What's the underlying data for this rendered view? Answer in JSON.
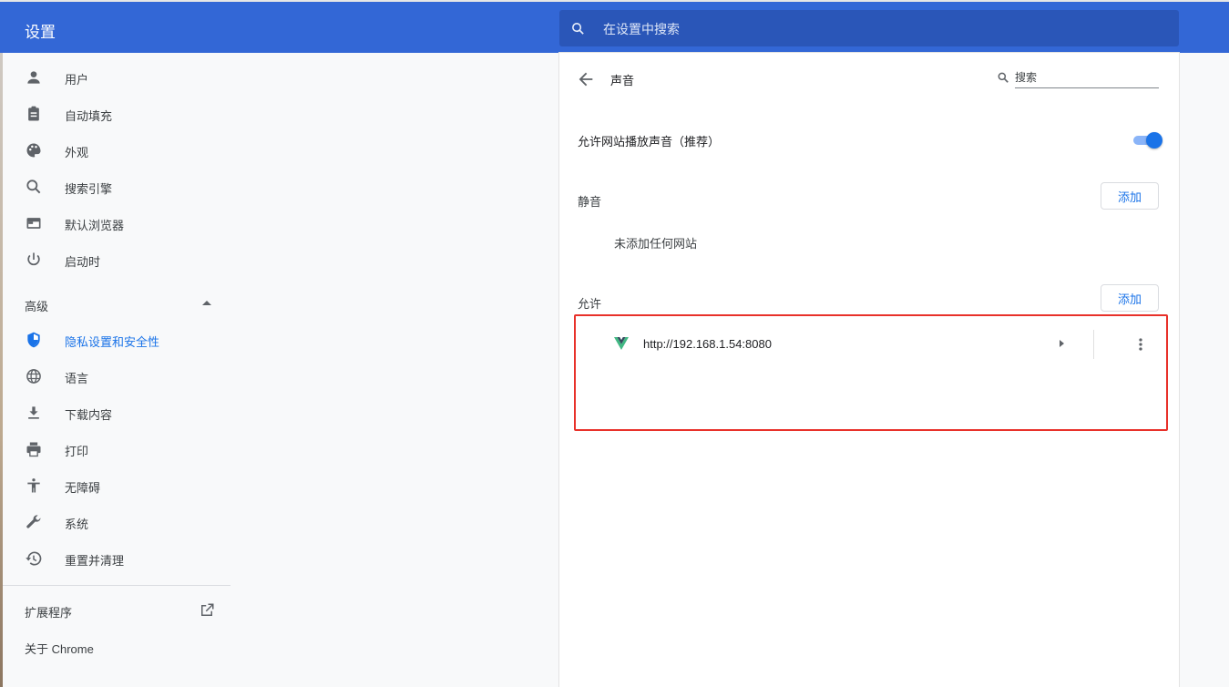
{
  "app": {
    "title": "设置"
  },
  "search": {
    "placeholder": "在设置中搜索"
  },
  "sidebar": {
    "items": [
      {
        "label": "用户",
        "icon": "person-icon"
      },
      {
        "label": "自动填充",
        "icon": "clipboard-icon"
      },
      {
        "label": "外观",
        "icon": "palette-icon"
      },
      {
        "label": "搜索引擎",
        "icon": "search-icon"
      },
      {
        "label": "默认浏览器",
        "icon": "browser-icon"
      },
      {
        "label": "启动时",
        "icon": "power-icon"
      }
    ],
    "advanced_label": "高级",
    "advanced_items": [
      {
        "label": "隐私设置和安全性",
        "icon": "shield-icon",
        "active": true
      },
      {
        "label": "语言",
        "icon": "globe-icon"
      },
      {
        "label": "下载内容",
        "icon": "download-icon"
      },
      {
        "label": "打印",
        "icon": "printer-icon"
      },
      {
        "label": "无障碍",
        "icon": "accessibility-icon"
      },
      {
        "label": "系统",
        "icon": "wrench-icon"
      },
      {
        "label": "重置并清理",
        "icon": "restore-icon"
      }
    ],
    "extensions_label": "扩展程序",
    "about_label": "关于 Chrome"
  },
  "page": {
    "title": "声音",
    "search_placeholder": "搜索",
    "allow_sound_label": "允许网站播放声音（推荐）",
    "allow_sound_enabled": true,
    "mute_section": {
      "label": "静音",
      "add_label": "添加",
      "empty_text": "未添加任何网站"
    },
    "allow_section": {
      "label": "允许",
      "add_label": "添加",
      "sites": [
        {
          "url": "http://192.168.1.54:8080",
          "favicon": "vue-logo-icon"
        }
      ]
    }
  },
  "colors": {
    "header": "#3367d6",
    "accent": "#1a73e8",
    "highlight_box": "#e8312a"
  }
}
